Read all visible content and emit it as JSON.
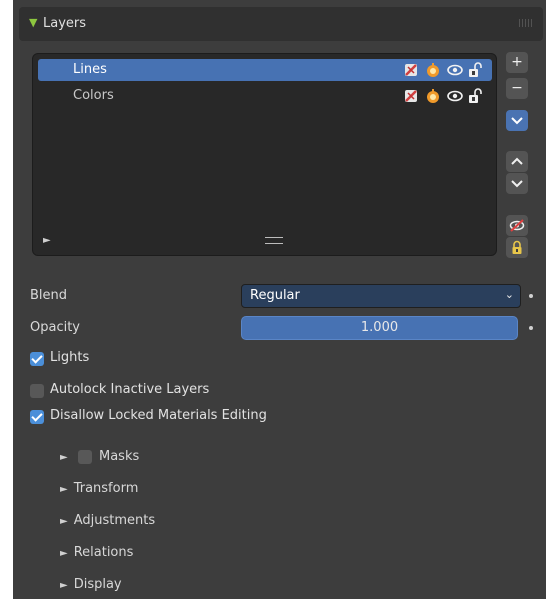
{
  "panel": {
    "title": "Layers",
    "header_icon": "triangle-down-icon",
    "accent": "#8dc63f"
  },
  "layers": [
    {
      "name": "Lines",
      "active": true
    },
    {
      "name": "Colors",
      "active": false
    }
  ],
  "side_buttons": {
    "add": "+",
    "remove": "−",
    "menu": "chevron-down-icon",
    "move_up": "move-up-icon",
    "move_down": "move-down-icon",
    "hide_others": "eye-hidden-icon",
    "lock": "lock-icon"
  },
  "properties": {
    "blend_label": "Blend",
    "blend_value": "Regular",
    "opacity_label": "Opacity",
    "opacity_value": "1.000",
    "lights_label": "Lights",
    "lights_checked": true,
    "autolock_label": "Autolock Inactive Layers",
    "autolock_checked": false,
    "disallow_label": "Disallow Locked Materials Editing",
    "disallow_checked": true
  },
  "subpanels": [
    "Masks",
    "Transform",
    "Adjustments",
    "Relations",
    "Display"
  ],
  "colors": {
    "selection": "#4772b3",
    "panel_bg": "#3d3d3d",
    "checkbox_on": "#4b8fd9"
  }
}
